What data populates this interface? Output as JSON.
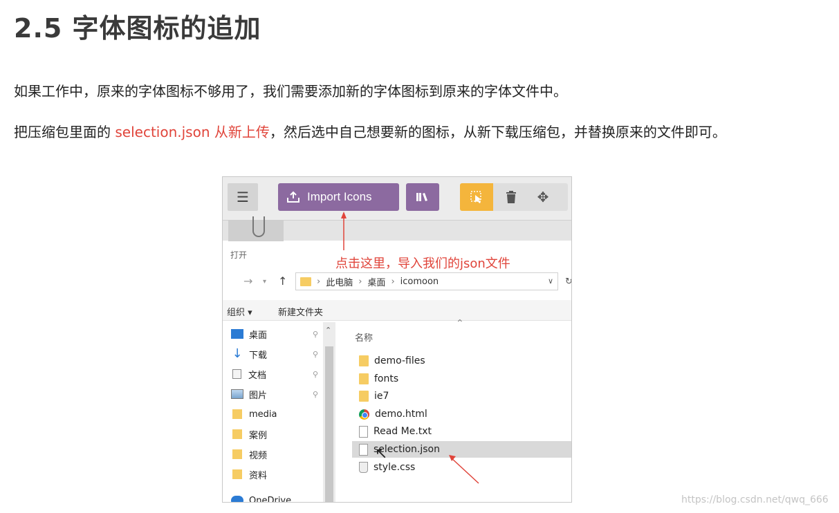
{
  "title": "2.5 字体图标的追加",
  "para1": "如果工作中，原来的字体图标不够用了，我们需要添加新的字体图标到原来的字体文件中。",
  "para2": {
    "pre": "把压缩包里面的 ",
    "highlight": "selection.json 从新上传",
    "post": "，然后选中自己想要新的图标，从新下载压缩包，并替换原来的文件即可。"
  },
  "screenshot": {
    "toolbar": {
      "menu_icon": "menu-icon",
      "import_label": "Import Icons",
      "import_icon": "upload-icon",
      "library_icon": "library-icon",
      "select_icon": "select-cursor-icon",
      "trash_icon": "trash-icon",
      "move_icon": "move-icon",
      "accent": "#8c6aa0",
      "select_accent": "#f4b53c"
    },
    "open_label": "打开",
    "annotation": "点击这里，导入我们的json文件",
    "address": {
      "segments": [
        "此电脑",
        "桌面",
        "icomoon"
      ]
    },
    "command_bar": {
      "organize": "组织 ▾",
      "new_folder": "新建文件夹"
    },
    "sidebar": [
      {
        "label": "桌面",
        "icon": "desktop-icon",
        "pinned": true
      },
      {
        "label": "下载",
        "icon": "download-icon",
        "pinned": true
      },
      {
        "label": "文档",
        "icon": "document-icon",
        "pinned": true
      },
      {
        "label": "图片",
        "icon": "picture-icon",
        "pinned": true
      },
      {
        "label": "media",
        "icon": "folder-icon",
        "pinned": false
      },
      {
        "label": "案例",
        "icon": "folder-icon",
        "pinned": false
      },
      {
        "label": "视频",
        "icon": "folder-icon",
        "pinned": false
      },
      {
        "label": "资料",
        "icon": "folder-icon",
        "pinned": false
      },
      {
        "label": "OneDrive",
        "icon": "cloud-icon",
        "pinned": false
      }
    ],
    "column_header": "名称",
    "files": [
      {
        "name": "demo-files",
        "type": "folder"
      },
      {
        "name": "fonts",
        "type": "folder"
      },
      {
        "name": "ie7",
        "type": "folder"
      },
      {
        "name": "demo.html",
        "type": "chrome"
      },
      {
        "name": "Read Me.txt",
        "type": "doc"
      },
      {
        "name": "selection.json",
        "type": "doc",
        "selected": true
      },
      {
        "name": "style.css",
        "type": "css"
      }
    ]
  },
  "watermark": "https://blog.csdn.net/qwq_666"
}
